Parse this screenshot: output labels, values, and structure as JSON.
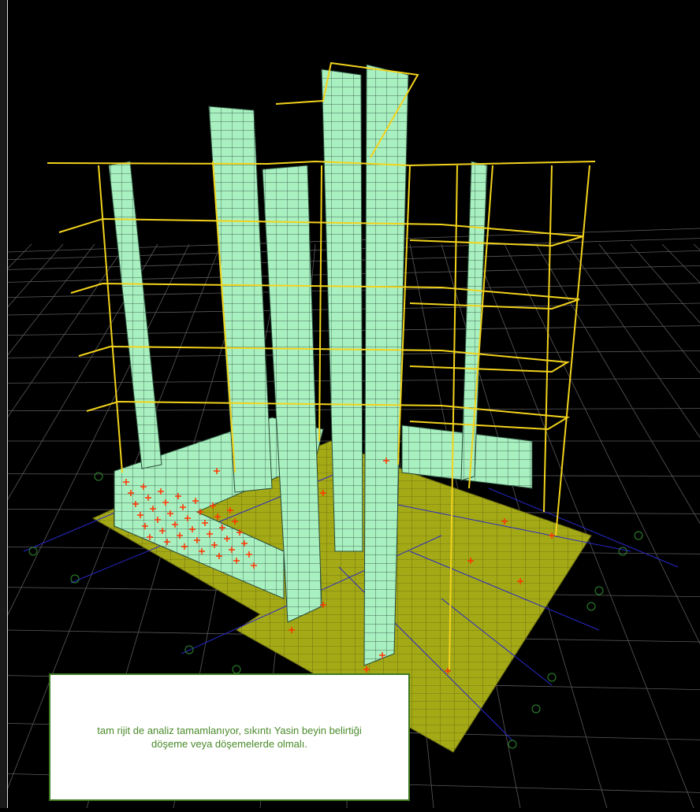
{
  "viewport": {
    "background_color": "#000000",
    "grid_color": "#5a5a5a",
    "wall_color": "#a8f0c0",
    "wall_mesh_color": "#1a3a2a",
    "frame_color": "#f0d020",
    "slab_color": "#a0a818",
    "support_color": "#ff3300",
    "axis_color": "#2828c8"
  },
  "note": {
    "line1": "tam rijit de analiz tamamlanıyor, sıkıntı Yasin beyin belirtiği",
    "line2": "döşeme veya döşemelerde olmalı.",
    "border_color": "#3f7a22",
    "text_color": "#4a8a2a"
  }
}
